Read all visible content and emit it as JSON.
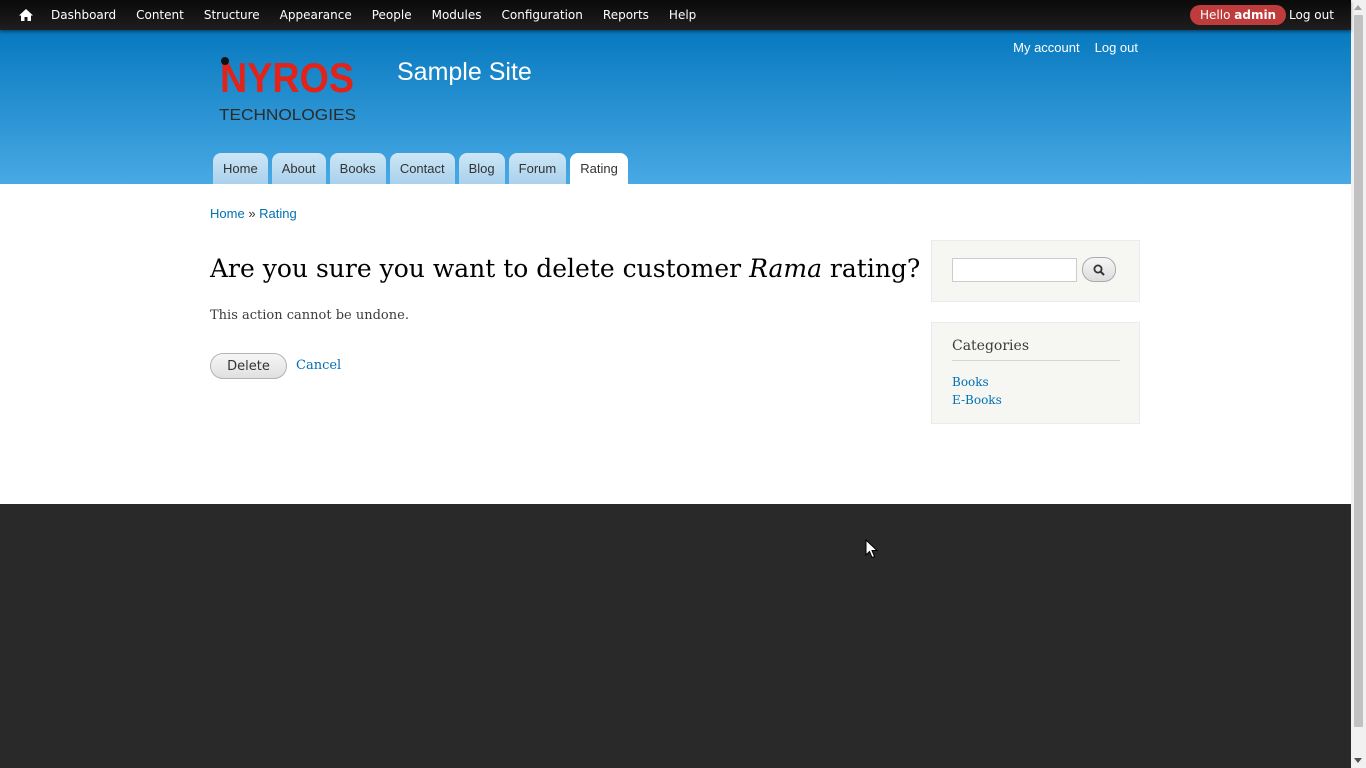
{
  "toolbar": {
    "home_icon": "home-icon",
    "menu": [
      "Dashboard",
      "Content",
      "Structure",
      "Appearance",
      "People",
      "Modules",
      "Configuration",
      "Reports",
      "Help"
    ],
    "hello_prefix": "Hello",
    "username": "admin",
    "logout": "Log out"
  },
  "header": {
    "logo_text": "NYROS",
    "logo_subtext": "TECHNOLOGIES",
    "site_name": "Sample Site",
    "secondary_links": [
      "My account",
      "Log out"
    ],
    "tabs": [
      "Home",
      "About",
      "Books",
      "Contact",
      "Blog",
      "Forum",
      "Rating"
    ],
    "active_tab": "Rating"
  },
  "breadcrumb": {
    "home": "Home",
    "separator": "»",
    "current": "Rating"
  },
  "main": {
    "title_before": "Are you sure you want to delete customer ",
    "title_name": "Rama",
    "title_after": " rating?",
    "description": "This action cannot be undone.",
    "delete_label": "Delete",
    "cancel_label": "Cancel"
  },
  "sidebar": {
    "search_icon": "search-icon",
    "categories_title": "Categories",
    "categories": [
      "Books",
      "E-Books"
    ]
  },
  "colors": {
    "header_top": "#0779bf",
    "header_bottom": "#48a9e4",
    "link": "#0071b3",
    "hello_badge": "#bf3c3c",
    "footer": "#292929"
  }
}
